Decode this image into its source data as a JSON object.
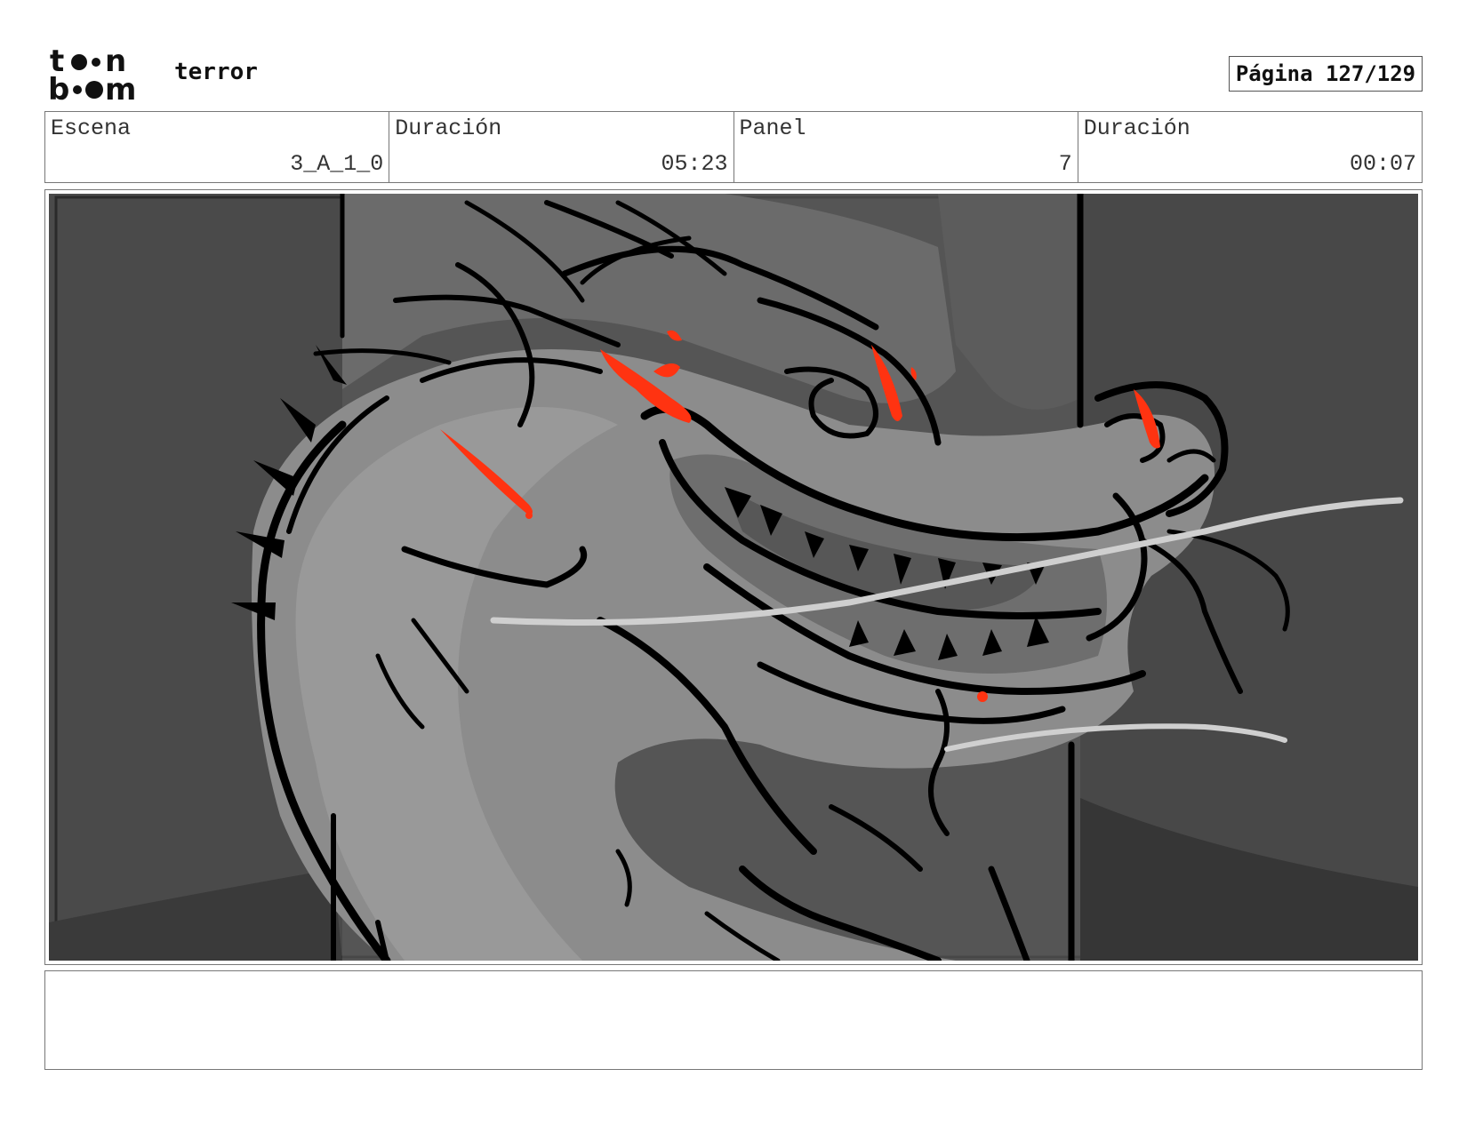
{
  "header": {
    "logo_text": "toon boom",
    "project_title": "terror",
    "page_label": "Página 127/129"
  },
  "info": {
    "scene_label": "Escena",
    "scene_value": "3_A_1_0",
    "scene_duration_label": "Duración",
    "scene_duration_value": "05:23",
    "panel_label": "Panel",
    "panel_value": "7",
    "panel_duration_label": "Duración",
    "panel_duration_value": "00:07"
  },
  "panel": {
    "image_icon": "dragon-sketch",
    "colors": {
      "background": "#4a4a4a",
      "mid_gray": "#666666",
      "light_gray": "#8a8a8a",
      "ink": "#000000",
      "accent_red": "#ff3311"
    }
  },
  "notes": {
    "text": ""
  }
}
